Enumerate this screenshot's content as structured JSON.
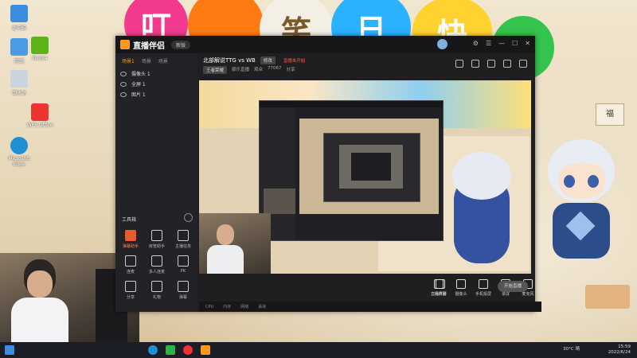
{
  "desktop": {
    "balloon_chars": [
      "叮",
      "笑",
      "日",
      "快"
    ],
    "icons": [
      {
        "label": "此电脑"
      },
      {
        "label": "网络"
      },
      {
        "label": "回收站"
      },
      {
        "label": "Microsoft Edge"
      },
      {
        "label": "WPS Office"
      },
      {
        "label": "Nvidia"
      }
    ],
    "mascot_sign": "福"
  },
  "app": {
    "title": "直播伴侣",
    "version_button": "新版",
    "side_tabs": [
      "场景1",
      "场景",
      "场景"
    ],
    "sources": [
      "摄像头 1",
      "全屏 1",
      "图片 1"
    ],
    "tools_header": "工具箱",
    "tools": [
      "弹幕助手",
      "房管助手",
      "主播任务",
      "连麦",
      "多人连麦",
      "PK",
      "分享",
      "礼物",
      "弹幕"
    ],
    "stream_title": "北部解说TTG vs WB",
    "tag_category": "修改",
    "tag_status": "直播未开始",
    "meta": [
      "王者荣耀",
      "娱乐直播",
      "观众",
      "77067",
      "分享"
    ],
    "bottom": [
      {
        "label": "直播屏幕"
      },
      {
        "label": "摄像头"
      },
      {
        "label": "手机投屏"
      },
      {
        "label": "录屏"
      },
      {
        "label": "麦克风"
      },
      {
        "label": "扬声器"
      }
    ],
    "live_button": "开始直播",
    "statusbar": [
      "CPU",
      "内存",
      "网络",
      "丢帧"
    ]
  },
  "taskbar": {
    "tray_temp": "30°C 晴",
    "time": "15:59",
    "date": "2022/6/24"
  },
  "colors": {
    "accent": "#ff9a1f",
    "brand_orange": "#e85a2c"
  }
}
